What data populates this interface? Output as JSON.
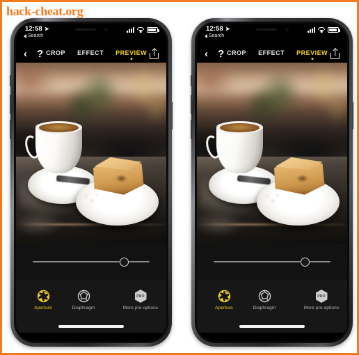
{
  "watermark": {
    "text": "hack-cheat.org",
    "color": "#f07c1e"
  },
  "border": {
    "color": "#f07c1e"
  },
  "theme": {
    "accent_yellow": "#f2d024",
    "screen_black": "#000000",
    "toolbar_bg": "#171717"
  },
  "phones": [
    {
      "id": "phone-left",
      "label": "iphone-left-mockup"
    },
    {
      "id": "phone-right",
      "label": "iphone-right-mockup"
    }
  ],
  "status_bar": {
    "time": "12:58",
    "location_arrow": "location-arrow-icon",
    "back_label": "Search",
    "signal": "cellular-signal-icon",
    "wifi": "wifi-icon",
    "battery": "battery-icon",
    "battery_level": "88"
  },
  "nav_bar": {
    "back": "‹",
    "help": "?",
    "share": "share-icon",
    "tabs": [
      {
        "label": "CROP",
        "active": false
      },
      {
        "label": "EFFECT",
        "active": false
      },
      {
        "label": "PREVIEW",
        "active": true
      }
    ]
  },
  "photo": {
    "description": "Coffee cup on saucer and slice of cake on white plate on dark cafe table with blurred bokeh background",
    "subject": "coffee-and-cake"
  },
  "slider": {
    "name": "aperture-blur-slider",
    "value": 78,
    "min": 0,
    "max": 100
  },
  "tools": [
    {
      "label": "Aperture",
      "icon": "aperture-icon",
      "active": true
    },
    {
      "label": "Diaphragm",
      "icon": "diaphragm-icon",
      "active": false
    },
    {
      "label": "More pro options",
      "icon": "pro-badge-icon",
      "active": false,
      "badge": "PRO"
    }
  ],
  "home_indicator": "home-indicator-bar"
}
